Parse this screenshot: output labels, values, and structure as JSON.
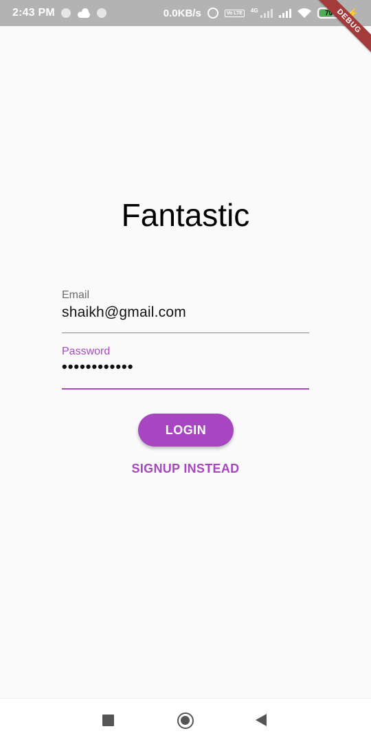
{
  "status_bar": {
    "time": "2:43 PM",
    "network_speed": "0.0KB/s",
    "volte": "Vo LTE",
    "network_type": "4G",
    "battery_level": "70",
    "battery_color": "#4caf50"
  },
  "debug_banner": "DEBUG",
  "app": {
    "title": "Fantastic",
    "accent_color": "#a646c0"
  },
  "form": {
    "email": {
      "label": "Email",
      "value": "shaikh@gmail.com"
    },
    "password": {
      "label": "Password",
      "value": "••••••••••••"
    },
    "login_label": "LOGIN",
    "signup_label": "SIGNUP INSTEAD"
  },
  "nav_bar": {
    "icons": [
      "recents-icon",
      "home-icon",
      "back-icon"
    ]
  }
}
